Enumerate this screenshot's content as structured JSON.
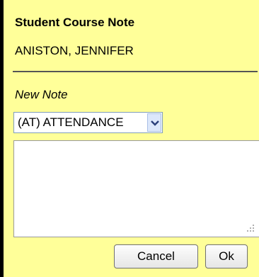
{
  "dialog": {
    "title": "Student Course Note",
    "student_name": "ANISTON, JENNIFER"
  },
  "form": {
    "new_note_label": "New Note",
    "note_type": {
      "selected": "(AT) ATTENDANCE"
    },
    "note_text": {
      "value": ""
    }
  },
  "buttons": {
    "cancel_label": "Cancel",
    "ok_label": "Ok"
  },
  "icons": {
    "dropdown": "chevron-down-icon",
    "resize": "resize-grip-icon"
  },
  "colors": {
    "panel_background": "#ffff99",
    "frame_border": "#000000"
  }
}
